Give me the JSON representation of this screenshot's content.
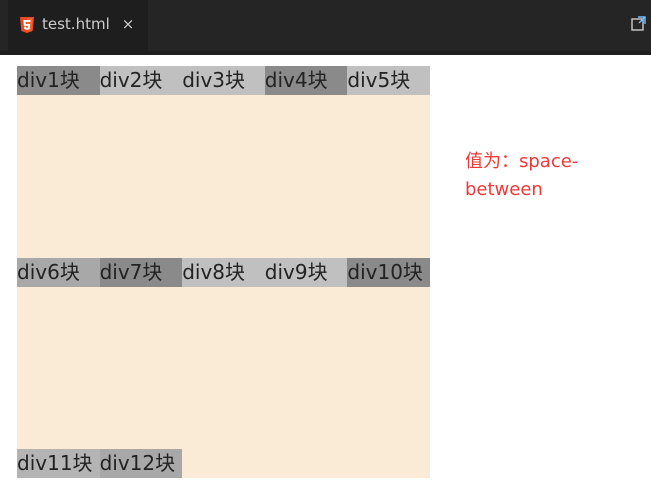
{
  "editor": {
    "tab_label": "test.html",
    "close_symbol": "×",
    "html_icon": "html5-icon",
    "action_icon": "open-preview-icon"
  },
  "colors": {
    "tabbar_bg": "#252526",
    "active_tab_bg": "#1e1e1e",
    "html5_orange": "#e34c26",
    "container_bg": "#faebd7",
    "note_red": "#ee3a3a"
  },
  "preview": {
    "items": [
      {
        "label": "div1块",
        "bg": "#8a8a8a"
      },
      {
        "label": "div2块",
        "bg": "#c0c0c0"
      },
      {
        "label": "div3块",
        "bg": "#c0c0c0"
      },
      {
        "label": "div4块",
        "bg": "#8a8a8a"
      },
      {
        "label": "div5块",
        "bg": "#c0c0c0"
      },
      {
        "label": "div6块",
        "bg": "#a8a8a8"
      },
      {
        "label": "div7块",
        "bg": "#8a8a8a"
      },
      {
        "label": "div8块",
        "bg": "#c0c0c0"
      },
      {
        "label": "div9块",
        "bg": "#c0c0c0"
      },
      {
        "label": "div10块",
        "bg": "#8a8a8a"
      },
      {
        "label": "div11块",
        "bg": "#b4b4b4"
      },
      {
        "label": "div12块",
        "bg": "#a8a8a8"
      }
    ],
    "note": "值为：space-between"
  }
}
